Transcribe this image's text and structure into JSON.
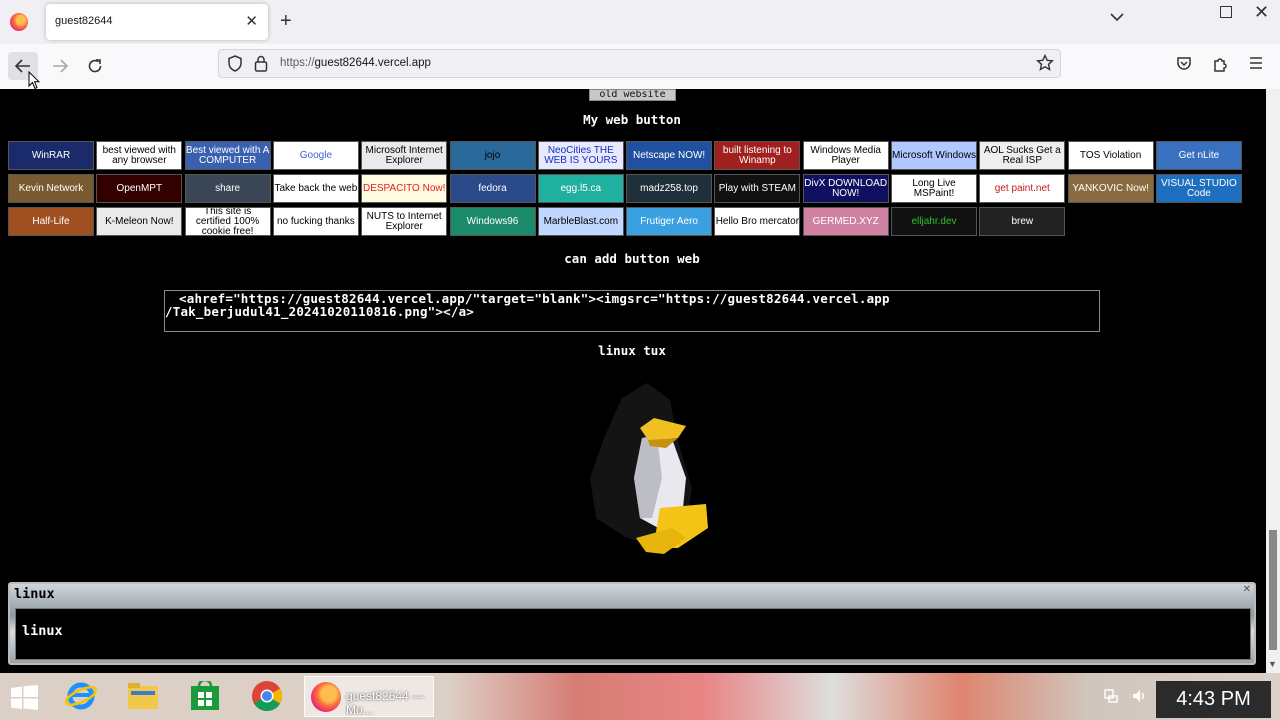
{
  "browser": {
    "tab_title": "guest82644",
    "url_prefix": "https://",
    "url_host": "guest82644.vercel.app"
  },
  "page": {
    "old_website_label": "old website",
    "my_web_button_heading": "My web button",
    "can_add_heading": "can add button web",
    "code_line1": "<ahref=\"https://guest82644.vercel.app/\"target=\"blank\"><imgsrc=\"https://guest82644.vercel.app",
    "code_line2": "/Tak_berjudul41_20241020110816.png\"></a>",
    "linux_tux_heading": "linux tux",
    "buttons": [
      {
        "label": "WinRAR",
        "bg": "#1a2a6a",
        "fg": "#fff"
      },
      {
        "label": "best viewed with any browser",
        "bg": "#fff",
        "fg": "#000"
      },
      {
        "label": "Best viewed with A COMPUTER",
        "bg": "#3a60b0",
        "fg": "#fff"
      },
      {
        "label": "Google",
        "bg": "#fff",
        "fg": "#4060d0"
      },
      {
        "label": "Microsoft Internet Explorer",
        "bg": "#eaeaea",
        "fg": "#000"
      },
      {
        "label": "jojo",
        "bg": "#2a6a9a",
        "fg": "#000"
      },
      {
        "label": "NeoCities THE WEB IS YOURS",
        "bg": "#e8e8ff",
        "fg": "#1030c0"
      },
      {
        "label": "Netscape NOW!",
        "bg": "#2050a0",
        "fg": "#fff"
      },
      {
        "label": "built listening to Winamp",
        "bg": "#a02020",
        "fg": "#fff"
      },
      {
        "label": "Windows Media Player",
        "bg": "#fff",
        "fg": "#000"
      },
      {
        "label": "Microsoft Windows",
        "bg": "#b0c8ff",
        "fg": "#000"
      },
      {
        "label": "AOL Sucks Get a Real ISP",
        "bg": "#eee",
        "fg": "#000"
      },
      {
        "label": "TOS Violation",
        "bg": "#fff",
        "fg": "#000"
      },
      {
        "label": "Get nLite",
        "bg": "#3a70c0",
        "fg": "#fff"
      },
      {
        "label": "Kevin Network",
        "bg": "#7a5a30",
        "fg": "#fff"
      },
      {
        "label": "OpenMPT",
        "bg": "#300",
        "fg": "#fff"
      },
      {
        "label": "share",
        "bg": "#3a4555",
        "fg": "#fff"
      },
      {
        "label": "Take back the web",
        "bg": "#fff",
        "fg": "#000"
      },
      {
        "label": "DESPACITO Now!",
        "bg": "#fffbe0",
        "fg": "#e02020"
      },
      {
        "label": "fedora",
        "bg": "#2a4a8a",
        "fg": "#fff"
      },
      {
        "label": "egg.l5.ca",
        "bg": "#20b0a0",
        "fg": "#fff"
      },
      {
        "label": "madz258.top",
        "bg": "#20303a",
        "fg": "#fff"
      },
      {
        "label": "Play with STEAM",
        "bg": "#111",
        "fg": "#fff"
      },
      {
        "label": "DivX DOWNLOAD NOW!",
        "bg": "#101060",
        "fg": "#fff"
      },
      {
        "label": "Long Live MSPaint!",
        "bg": "#fff",
        "fg": "#000"
      },
      {
        "label": "get paint.net",
        "bg": "#fff",
        "fg": "#c02020"
      },
      {
        "label": "YANKOVIC Now!",
        "bg": "#8a6a40",
        "fg": "#fff"
      },
      {
        "label": "VISUAL STUDIO Code",
        "bg": "#1f6fc0",
        "fg": "#fff"
      },
      {
        "label": "Half-Life",
        "bg": "#a05020",
        "fg": "#fff"
      },
      {
        "label": "K-Meleon Now!",
        "bg": "#eaeaea",
        "fg": "#000"
      },
      {
        "label": "This site is certified 100% cookie free!",
        "bg": "#fff",
        "fg": "#000"
      },
      {
        "label": "no fucking thanks",
        "bg": "#fff",
        "fg": "#000"
      },
      {
        "label": "NUTS to Internet Explorer",
        "bg": "#fff",
        "fg": "#000"
      },
      {
        "label": "Windows96",
        "bg": "#1a8a6a",
        "fg": "#fff"
      },
      {
        "label": "MarbleBlast.com",
        "bg": "#c0d8ff",
        "fg": "#000"
      },
      {
        "label": "Frutiger Aero",
        "bg": "#3aa0e0",
        "fg": "#fff"
      },
      {
        "label": "Hello Bro mercator",
        "bg": "#fff",
        "fg": "#000"
      },
      {
        "label": "GERMED.XYZ",
        "bg": "#d080a0",
        "fg": "#fff"
      },
      {
        "label": "elljahr.dev",
        "bg": "#111",
        "fg": "#30c030"
      },
      {
        "label": "brew",
        "bg": "#222",
        "fg": "#fff"
      }
    ]
  },
  "chat": {
    "title": "linux",
    "message": "linux"
  },
  "taskbar": {
    "firefox_label": "guest82644 — Mo...",
    "clock": "4:43 PM"
  }
}
